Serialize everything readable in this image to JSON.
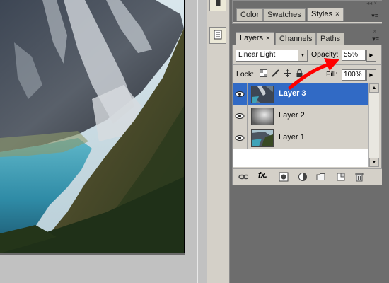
{
  "swatches_panel": {
    "tabs": [
      {
        "label": "Color"
      },
      {
        "label": "Swatches"
      },
      {
        "label": "Styles",
        "close": "×"
      }
    ]
  },
  "layers_panel": {
    "tabs": [
      {
        "label": "Layers",
        "close": "×"
      },
      {
        "label": "Channels"
      },
      {
        "label": "Paths"
      }
    ],
    "blend_mode": "Linear Light",
    "opacity_label": "Opacity:",
    "opacity_value": "55%",
    "lock_label": "Lock:",
    "fill_label": "Fill:",
    "fill_value": "100%",
    "layers": [
      {
        "name": "Layer 3",
        "selected": true,
        "visible": true
      },
      {
        "name": "Layer 2",
        "selected": false,
        "visible": true
      },
      {
        "name": "Layer 1",
        "selected": false,
        "visible": true
      }
    ],
    "footer_icons": [
      "link-icon",
      "fx-icon",
      "mask-icon",
      "adjustment-icon",
      "folder-icon",
      "new-layer-icon",
      "trash-icon"
    ],
    "fx_label": "fx."
  },
  "annotation": {
    "color": "#ff0000"
  },
  "colors": {
    "selection": "#316ac5",
    "panel": "#d4d0c8",
    "dock": "#6d6d6d"
  }
}
